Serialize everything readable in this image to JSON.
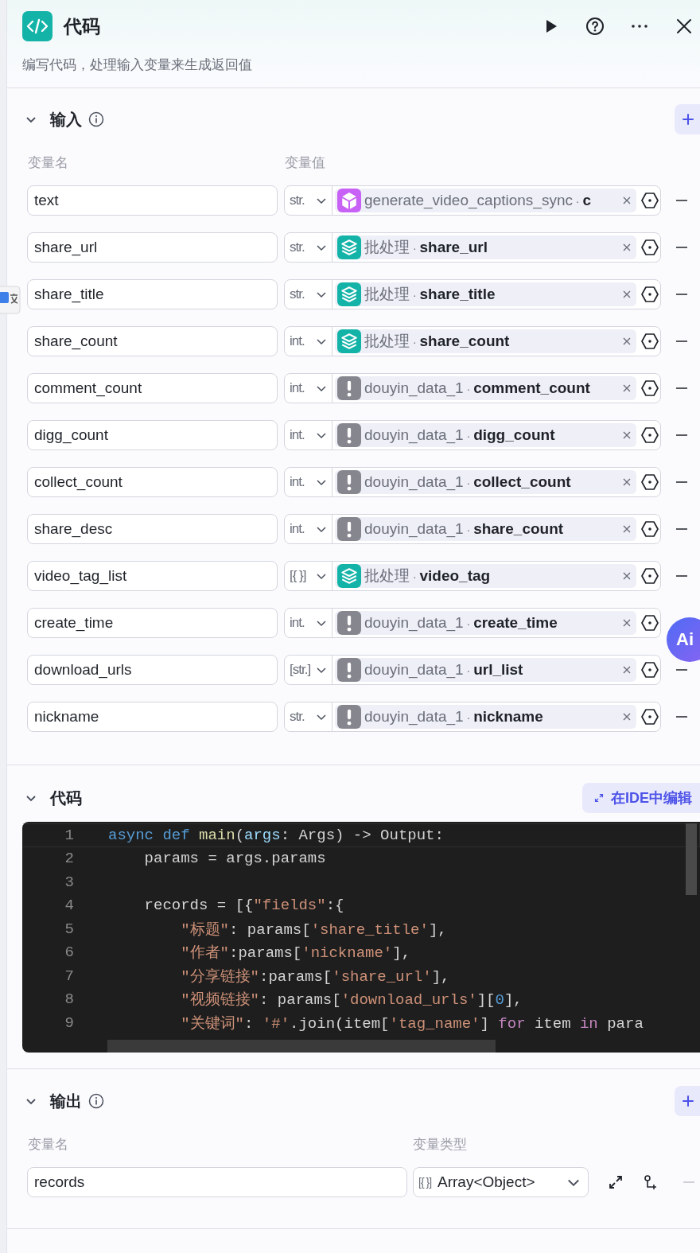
{
  "header": {
    "title": "代码",
    "subtitle": "编写代码，处理输入变量来生成返回值"
  },
  "inputs": {
    "title": "输入",
    "columns": [
      "变量名",
      "变量值"
    ],
    "rows": [
      {
        "name": "text",
        "type": "str.",
        "kind": "plugin",
        "source": "generate_video_captions_sync",
        "sep": "·",
        "field": "c"
      },
      {
        "name": "share_url",
        "type": "str.",
        "kind": "batch",
        "source": "批处理",
        "sep": "·",
        "field": "share_url"
      },
      {
        "name": "share_title",
        "type": "str.",
        "kind": "batch",
        "source": "批处理",
        "sep": "·",
        "field": "share_title"
      },
      {
        "name": "share_count",
        "type": "int.",
        "kind": "batch",
        "source": "批处理",
        "sep": "·",
        "field": "share_count"
      },
      {
        "name": "comment_count",
        "type": "int.",
        "kind": "warning",
        "source": "douyin_data_1",
        "sep": "·",
        "field": "comment_count"
      },
      {
        "name": "digg_count",
        "type": "int.",
        "kind": "warning",
        "source": "douyin_data_1",
        "sep": "·",
        "field": "digg_count"
      },
      {
        "name": "collect_count",
        "type": "int.",
        "kind": "warning",
        "source": "douyin_data_1",
        "sep": "·",
        "field": "collect_count"
      },
      {
        "name": "share_desc",
        "type": "int.",
        "kind": "warning",
        "source": "douyin_data_1",
        "sep": "·",
        "field": "share_count"
      },
      {
        "name": "video_tag_list",
        "type": "[{ }]",
        "kind": "batch",
        "source": "批处理",
        "sep": "·",
        "field": "video_tag"
      },
      {
        "name": "create_time",
        "type": "int.",
        "kind": "warning",
        "source": "douyin_data_1",
        "sep": "·",
        "field": "create_time"
      },
      {
        "name": "download_urls",
        "type": "[str.]",
        "kind": "warning",
        "source": "douyin_data_1",
        "sep": "·",
        "field": "url_list"
      },
      {
        "name": "nickname",
        "type": "str.",
        "kind": "warning",
        "source": "douyin_data_1",
        "sep": "·",
        "field": "nickname"
      }
    ]
  },
  "code": {
    "title": "代码",
    "ide_button": "在IDE中编辑",
    "lines": [
      {
        "no": "1",
        "current": true,
        "tokens": [
          {
            "kind": "kw",
            "text": "async def "
          },
          {
            "kind": "fn",
            "text": "main"
          },
          {
            "kind": "p",
            "text": "("
          },
          {
            "kind": "var",
            "text": "args"
          },
          {
            "kind": "p",
            "text": ": Args) -> Output:"
          }
        ]
      },
      {
        "no": "2",
        "current": false,
        "tokens": [
          {
            "kind": "p",
            "text": "    params = args.params"
          }
        ]
      },
      {
        "no": "3",
        "current": false
      },
      {
        "no": "4",
        "current": false,
        "tokens": [
          {
            "kind": "p",
            "text": "    records = [{"
          },
          {
            "kind": "s",
            "text": "\"fields\""
          },
          {
            "kind": "p",
            "text": ":{"
          }
        ]
      },
      {
        "no": "5",
        "current": false,
        "tokens": [
          {
            "kind": "s",
            "text": "        \"标题\""
          },
          {
            "kind": "p",
            "text": ": params["
          },
          {
            "kind": "s",
            "text": "'share_title'"
          },
          {
            "kind": "p",
            "text": "],"
          }
        ]
      },
      {
        "no": "6",
        "current": false,
        "tokens": [
          {
            "kind": "s",
            "text": "        \"作者\""
          },
          {
            "kind": "p",
            "text": ":params["
          },
          {
            "kind": "s",
            "text": "'nickname'"
          },
          {
            "kind": "p",
            "text": "],"
          }
        ]
      },
      {
        "no": "7",
        "current": false,
        "tokens": [
          {
            "kind": "s",
            "text": "        \"分享链接\""
          },
          {
            "kind": "p",
            "text": ":params["
          },
          {
            "kind": "s",
            "text": "'share_url'"
          },
          {
            "kind": "p",
            "text": "],"
          }
        ]
      },
      {
        "no": "8",
        "current": false,
        "tokens": [
          {
            "kind": "s",
            "text": "        \"视频链接\""
          },
          {
            "kind": "p",
            "text": ": params["
          },
          {
            "kind": "s",
            "text": "'download_urls'"
          },
          {
            "kind": "p",
            "text": "]["
          },
          {
            "kind": "n",
            "text": "0"
          },
          {
            "kind": "p",
            "text": "],"
          }
        ]
      },
      {
        "no": "9",
        "current": false,
        "tokens": [
          {
            "kind": "s",
            "text": "        \"关键词\""
          },
          {
            "kind": "p",
            "text": ": "
          },
          {
            "kind": "s",
            "text": "'#'"
          },
          {
            "kind": "p",
            "text": ".join(item["
          },
          {
            "kind": "s",
            "text": "'tag_name'"
          },
          {
            "kind": "p",
            "text": "] "
          },
          {
            "kind": "ctl",
            "text": "for"
          },
          {
            "kind": "p",
            "text": " item "
          },
          {
            "kind": "ctl",
            "text": "in"
          },
          {
            "kind": "p",
            "text": " para"
          }
        ]
      }
    ]
  },
  "outputs": {
    "title": "输出",
    "columns": [
      "变量名",
      "变量类型"
    ],
    "rows": [
      {
        "name": "records",
        "type_icon": "[{ }]",
        "type": "Array<Object>"
      }
    ]
  },
  "assistant": {
    "label": "Ai"
  }
}
